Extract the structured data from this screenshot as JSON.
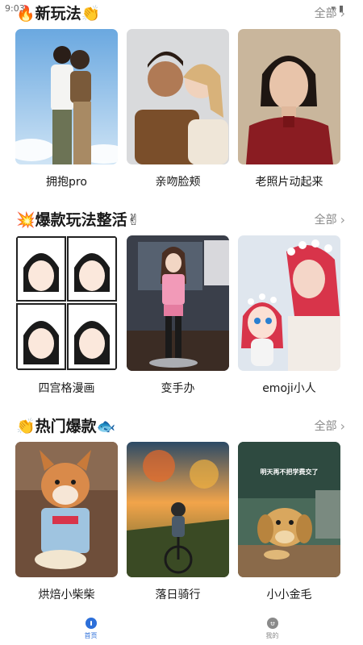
{
  "status_bar": {
    "time": "9:03"
  },
  "sections": [
    {
      "title": "🔥新玩法👏",
      "see_all": "全部",
      "cards": [
        {
          "label": "拥抱pro"
        },
        {
          "label": "亲吻脸颊"
        },
        {
          "label": "老照片动起来"
        }
      ]
    },
    {
      "title": "💥爆款玩法整活✌",
      "see_all": "全部",
      "cards": [
        {
          "label": "四宫格漫画"
        },
        {
          "label": "变手办"
        },
        {
          "label": "emoji小人"
        }
      ]
    },
    {
      "title": "👏热门爆款🐟",
      "see_all": "全部",
      "cards": [
        {
          "label": "烘焙小柴柴"
        },
        {
          "label": "落日骑行"
        },
        {
          "label": "小小金毛",
          "caption": "明天再不把学费交了"
        }
      ]
    }
  ],
  "tabbar": {
    "items": [
      {
        "label": "首页",
        "icon": "home-icon",
        "active": true
      },
      {
        "label": "我的",
        "icon": "profile-icon",
        "active": false
      }
    ]
  },
  "colors": {
    "accent": "#2c6fd9",
    "muted": "#8a8a8a"
  }
}
